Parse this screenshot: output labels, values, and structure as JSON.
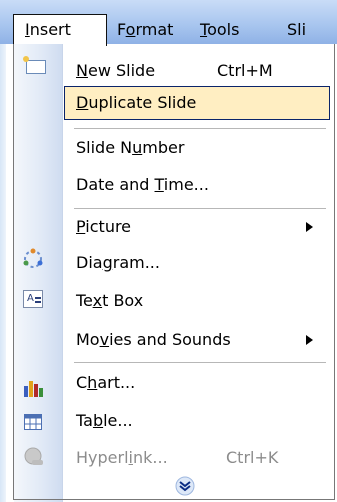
{
  "menubar": {
    "items": [
      {
        "label": "Insert",
        "mnemonic": "I"
      },
      {
        "label": "Format",
        "mnemonic": "o"
      },
      {
        "label": "Tools",
        "mnemonic": "T"
      },
      {
        "label": "Sli"
      }
    ]
  },
  "menu": {
    "items": [
      {
        "label": "New Slide",
        "shortcut": "Ctrl+M",
        "icon": "new-slide-icon"
      },
      {
        "label": "Duplicate Slide",
        "highlighted": true
      },
      {
        "label": "Slide Number"
      },
      {
        "label": "Date and Time..."
      },
      {
        "label": "Picture",
        "submenu": true
      },
      {
        "label": "Diagram...",
        "icon": "diagram-icon"
      },
      {
        "label": "Text Box",
        "icon": "text-box-icon"
      },
      {
        "label": "Movies and Sounds",
        "submenu": true
      },
      {
        "label": "Chart...",
        "icon": "chart-icon"
      },
      {
        "label": "Table...",
        "icon": "table-icon"
      },
      {
        "label": "Hyperlink...",
        "shortcut": "Ctrl+K",
        "icon": "hyperlink-icon",
        "disabled": true
      }
    ],
    "expand_icon": "expand-chevron-icon"
  },
  "colors": {
    "highlight_bg": "#ffeec2",
    "highlight_border": "#0a246a",
    "menubar_gradient": "#a9c6ef",
    "disabled_text": "#8c8c8c"
  }
}
